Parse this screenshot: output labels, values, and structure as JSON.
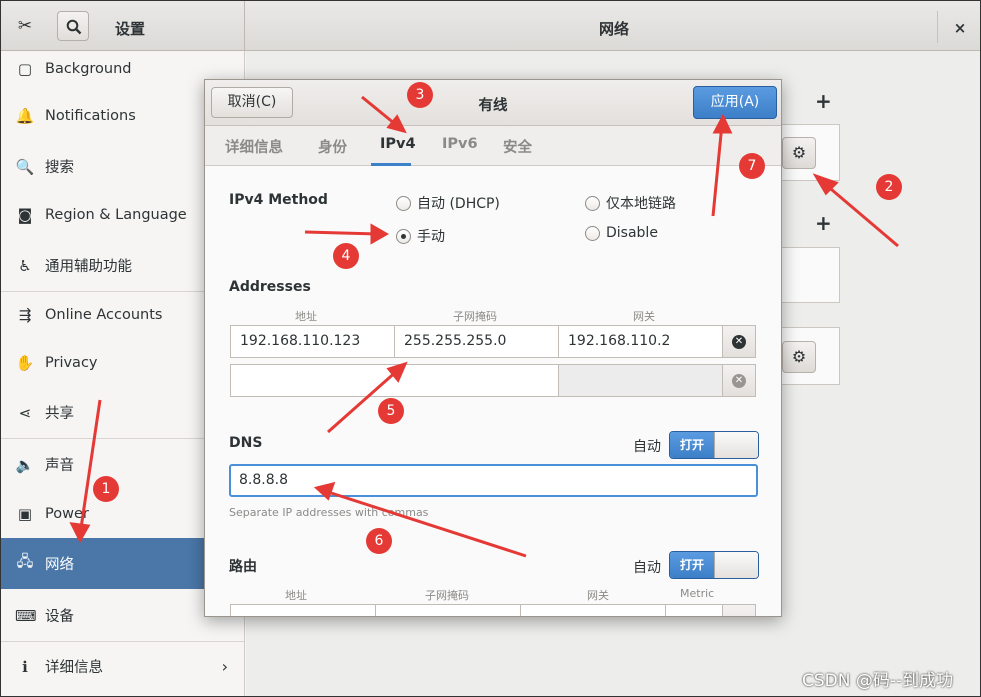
{
  "window": {
    "settings_title": "设置",
    "network_title": "网络",
    "close_glyph": "×"
  },
  "sidebar": {
    "items": [
      {
        "label": "Background",
        "icon": "▢"
      },
      {
        "label": "Notifications",
        "icon": "🔔"
      },
      {
        "label": "搜索",
        "icon": "🔍"
      },
      {
        "label": "Region & Language",
        "icon": "◙"
      },
      {
        "label": "通用辅助功能",
        "icon": "♿"
      },
      {
        "label": "Online Accounts",
        "icon": "⇶"
      },
      {
        "label": "Privacy",
        "icon": "✋"
      },
      {
        "label": "共享",
        "icon": "⋖"
      },
      {
        "label": "声音",
        "icon": "🔈"
      },
      {
        "label": "Power",
        "icon": "▣"
      },
      {
        "label": "网络",
        "icon": "🖧"
      },
      {
        "label": "设备",
        "icon": "⌨"
      },
      {
        "label": "详细信息",
        "icon": "ℹ"
      }
    ],
    "chevron": "›"
  },
  "right_panel": {
    "plus1": "+",
    "plus2": "+",
    "gear": "⚙"
  },
  "dialog": {
    "cancel_label": "取消(C)",
    "title": "有线",
    "apply_label": "应用(A)",
    "tabs": [
      "详细信息",
      "身份",
      "IPv4",
      "IPv6",
      "安全"
    ],
    "active_tab": "IPv4",
    "ipv4_method_label": "IPv4 Method",
    "methods": {
      "dhcp": "自动 (DHCP)",
      "link_local": "仅本地链路",
      "manual": "手动",
      "disable": "Disable"
    },
    "selected_method": "手动",
    "addresses_label": "Addresses",
    "columns": {
      "address": "地址",
      "netmask": "子网掩码",
      "gateway": "网关"
    },
    "address_rows": [
      {
        "address": "192.168.110.123",
        "netmask": "255.255.255.0",
        "gateway": "192.168.110.2"
      },
      {
        "address": "",
        "netmask": "",
        "gateway": ""
      }
    ],
    "dns_label": "DNS",
    "auto_label": "自动",
    "switch_on": "打开",
    "dns_value": "8.8.8.8",
    "dns_hint": "Separate IP addresses with commas",
    "routes_label": "路由",
    "route_columns": {
      "address": "地址",
      "netmask": "子网掩码",
      "gateway": "网关",
      "metric": "Metric"
    }
  },
  "annotations": {
    "badges": [
      "1",
      "2",
      "3",
      "4",
      "5",
      "6",
      "7"
    ],
    "color": "#e53935"
  },
  "watermark": "CSDN @码--到成功"
}
